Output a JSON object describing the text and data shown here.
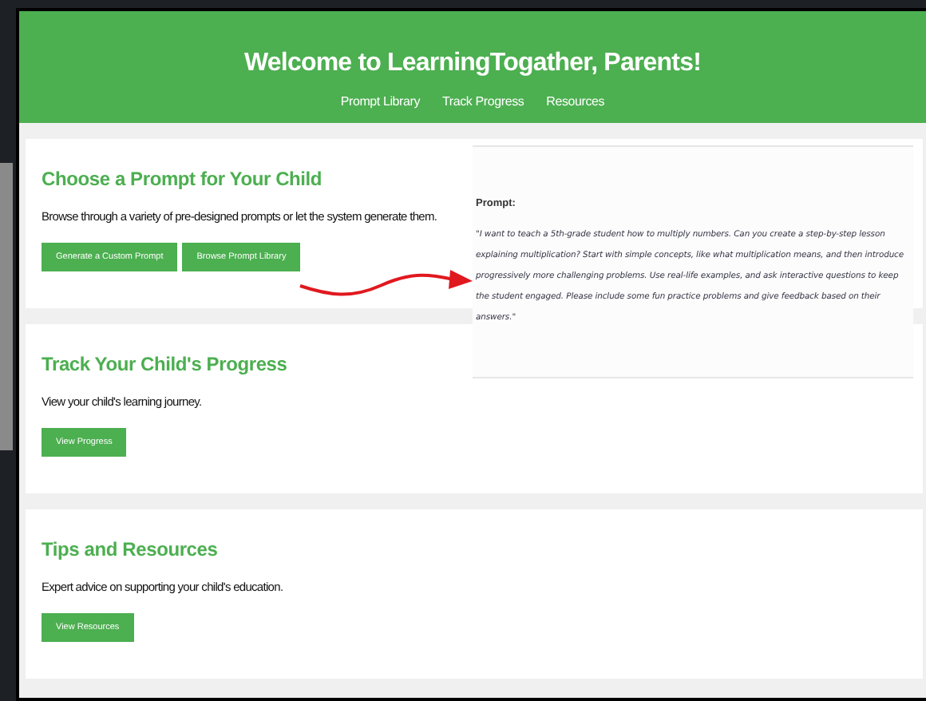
{
  "header": {
    "title": "Welcome to LearningTogather, Parents!",
    "nav": [
      "Prompt Library",
      "Track Progress",
      "Resources"
    ]
  },
  "sections": [
    {
      "title": "Choose a Prompt for Your Child",
      "description": "Browse through a variety of pre-designed prompts or let the system generate them.",
      "buttons": [
        "Generate a Custom Prompt",
        "Browse Prompt Library"
      ]
    },
    {
      "title": "Track Your Child's Progress",
      "description": "View your child's learning journey.",
      "buttons": [
        "View Progress"
      ]
    },
    {
      "title": "Tips and Resources",
      "description": "Expert advice on supporting your child's education.",
      "buttons": [
        "View Resources"
      ]
    }
  ],
  "prompt_panel": {
    "label": "Prompt:",
    "text": "\"I want to teach a 5th-grade student how to multiply numbers. Can you create a step-by-step lesson explaining multiplication? Start with simple concepts, like what multiplication means, and then introduce progressively more challenging problems. Use real-life examples, and ask interactive questions to keep the student engaged. Please include some fun practice problems and give feedback based on their answers.\""
  }
}
